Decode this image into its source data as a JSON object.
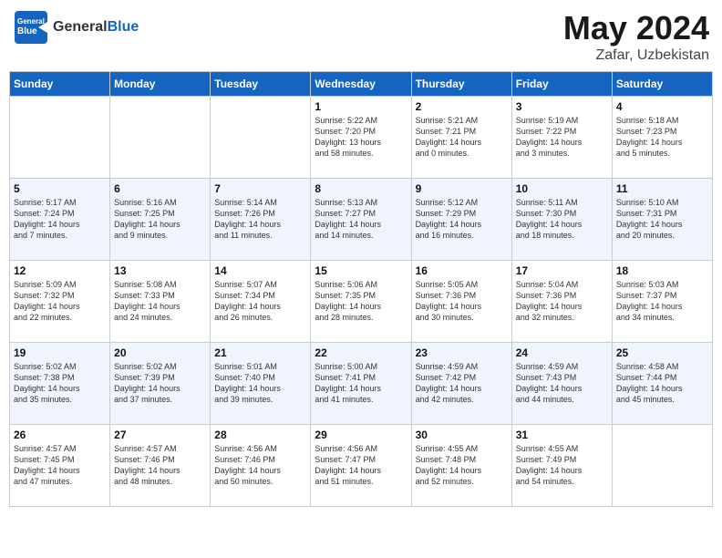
{
  "header": {
    "logo_general": "General",
    "logo_blue": "Blue",
    "month": "May 2024",
    "location": "Zafar, Uzbekistan"
  },
  "weekdays": [
    "Sunday",
    "Monday",
    "Tuesday",
    "Wednesday",
    "Thursday",
    "Friday",
    "Saturday"
  ],
  "weeks": [
    {
      "shaded": false,
      "days": [
        {
          "num": "",
          "info": ""
        },
        {
          "num": "",
          "info": ""
        },
        {
          "num": "",
          "info": ""
        },
        {
          "num": "1",
          "info": "Sunrise: 5:22 AM\nSunset: 7:20 PM\nDaylight: 13 hours\nand 58 minutes."
        },
        {
          "num": "2",
          "info": "Sunrise: 5:21 AM\nSunset: 7:21 PM\nDaylight: 14 hours\nand 0 minutes."
        },
        {
          "num": "3",
          "info": "Sunrise: 5:19 AM\nSunset: 7:22 PM\nDaylight: 14 hours\nand 3 minutes."
        },
        {
          "num": "4",
          "info": "Sunrise: 5:18 AM\nSunset: 7:23 PM\nDaylight: 14 hours\nand 5 minutes."
        }
      ]
    },
    {
      "shaded": true,
      "days": [
        {
          "num": "5",
          "info": "Sunrise: 5:17 AM\nSunset: 7:24 PM\nDaylight: 14 hours\nand 7 minutes."
        },
        {
          "num": "6",
          "info": "Sunrise: 5:16 AM\nSunset: 7:25 PM\nDaylight: 14 hours\nand 9 minutes."
        },
        {
          "num": "7",
          "info": "Sunrise: 5:14 AM\nSunset: 7:26 PM\nDaylight: 14 hours\nand 11 minutes."
        },
        {
          "num": "8",
          "info": "Sunrise: 5:13 AM\nSunset: 7:27 PM\nDaylight: 14 hours\nand 14 minutes."
        },
        {
          "num": "9",
          "info": "Sunrise: 5:12 AM\nSunset: 7:29 PM\nDaylight: 14 hours\nand 16 minutes."
        },
        {
          "num": "10",
          "info": "Sunrise: 5:11 AM\nSunset: 7:30 PM\nDaylight: 14 hours\nand 18 minutes."
        },
        {
          "num": "11",
          "info": "Sunrise: 5:10 AM\nSunset: 7:31 PM\nDaylight: 14 hours\nand 20 minutes."
        }
      ]
    },
    {
      "shaded": false,
      "days": [
        {
          "num": "12",
          "info": "Sunrise: 5:09 AM\nSunset: 7:32 PM\nDaylight: 14 hours\nand 22 minutes."
        },
        {
          "num": "13",
          "info": "Sunrise: 5:08 AM\nSunset: 7:33 PM\nDaylight: 14 hours\nand 24 minutes."
        },
        {
          "num": "14",
          "info": "Sunrise: 5:07 AM\nSunset: 7:34 PM\nDaylight: 14 hours\nand 26 minutes."
        },
        {
          "num": "15",
          "info": "Sunrise: 5:06 AM\nSunset: 7:35 PM\nDaylight: 14 hours\nand 28 minutes."
        },
        {
          "num": "16",
          "info": "Sunrise: 5:05 AM\nSunset: 7:36 PM\nDaylight: 14 hours\nand 30 minutes."
        },
        {
          "num": "17",
          "info": "Sunrise: 5:04 AM\nSunset: 7:36 PM\nDaylight: 14 hours\nand 32 minutes."
        },
        {
          "num": "18",
          "info": "Sunrise: 5:03 AM\nSunset: 7:37 PM\nDaylight: 14 hours\nand 34 minutes."
        }
      ]
    },
    {
      "shaded": true,
      "days": [
        {
          "num": "19",
          "info": "Sunrise: 5:02 AM\nSunset: 7:38 PM\nDaylight: 14 hours\nand 35 minutes."
        },
        {
          "num": "20",
          "info": "Sunrise: 5:02 AM\nSunset: 7:39 PM\nDaylight: 14 hours\nand 37 minutes."
        },
        {
          "num": "21",
          "info": "Sunrise: 5:01 AM\nSunset: 7:40 PM\nDaylight: 14 hours\nand 39 minutes."
        },
        {
          "num": "22",
          "info": "Sunrise: 5:00 AM\nSunset: 7:41 PM\nDaylight: 14 hours\nand 41 minutes."
        },
        {
          "num": "23",
          "info": "Sunrise: 4:59 AM\nSunset: 7:42 PM\nDaylight: 14 hours\nand 42 minutes."
        },
        {
          "num": "24",
          "info": "Sunrise: 4:59 AM\nSunset: 7:43 PM\nDaylight: 14 hours\nand 44 minutes."
        },
        {
          "num": "25",
          "info": "Sunrise: 4:58 AM\nSunset: 7:44 PM\nDaylight: 14 hours\nand 45 minutes."
        }
      ]
    },
    {
      "shaded": false,
      "days": [
        {
          "num": "26",
          "info": "Sunrise: 4:57 AM\nSunset: 7:45 PM\nDaylight: 14 hours\nand 47 minutes."
        },
        {
          "num": "27",
          "info": "Sunrise: 4:57 AM\nSunset: 7:46 PM\nDaylight: 14 hours\nand 48 minutes."
        },
        {
          "num": "28",
          "info": "Sunrise: 4:56 AM\nSunset: 7:46 PM\nDaylight: 14 hours\nand 50 minutes."
        },
        {
          "num": "29",
          "info": "Sunrise: 4:56 AM\nSunset: 7:47 PM\nDaylight: 14 hours\nand 51 minutes."
        },
        {
          "num": "30",
          "info": "Sunrise: 4:55 AM\nSunset: 7:48 PM\nDaylight: 14 hours\nand 52 minutes."
        },
        {
          "num": "31",
          "info": "Sunrise: 4:55 AM\nSunset: 7:49 PM\nDaylight: 14 hours\nand 54 minutes."
        },
        {
          "num": "",
          "info": ""
        }
      ]
    }
  ]
}
